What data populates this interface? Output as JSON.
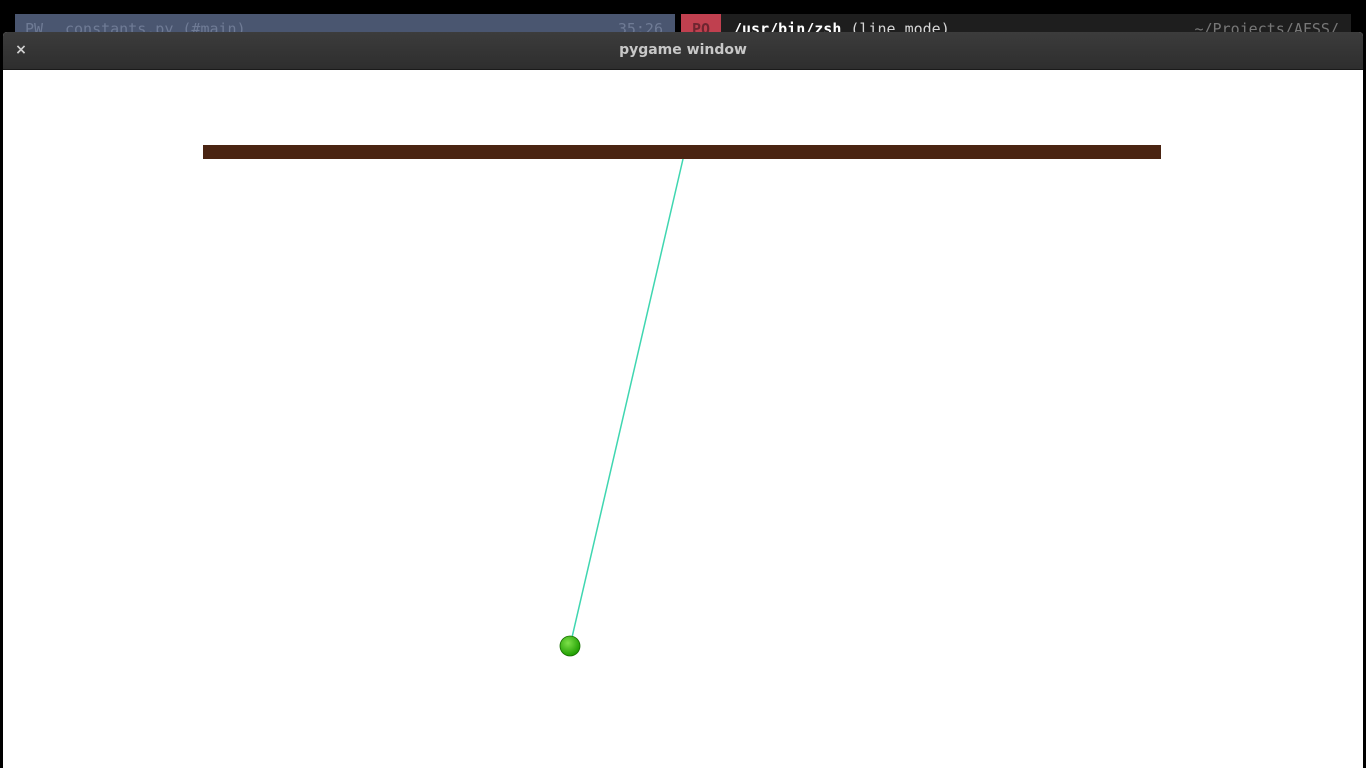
{
  "background": {
    "left_bar": {
      "tag": "PW",
      "file": "constants.py (#main)",
      "position": "35:26"
    },
    "right_bar": {
      "tag": "PO",
      "shell": "/usr/bin/zsh",
      "mode": "(line mode)",
      "path": "~/Projects/AFSS/"
    }
  },
  "window": {
    "title": "pygame window",
    "close_label": "×"
  },
  "scene": {
    "colors": {
      "beam": "#4a2412",
      "string": "#3fd6b0",
      "bob": "#1e9d00",
      "bob_highlight": "#7ee04a",
      "background": "#ffffff"
    }
  }
}
